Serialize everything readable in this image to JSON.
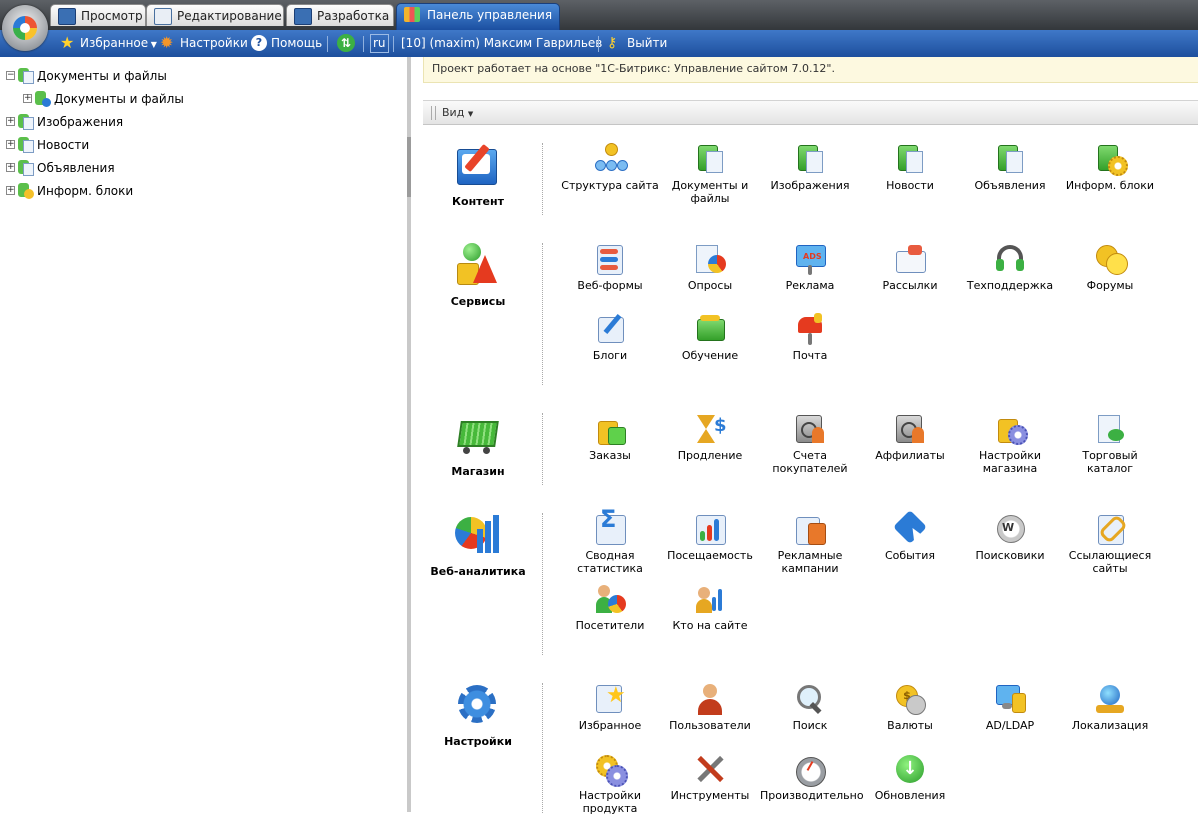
{
  "tabs": [
    {
      "label": "Просмотр",
      "color": "#3a6fb3"
    },
    {
      "label": "Редактирование",
      "color": "#3a6fb3"
    },
    {
      "label": "Разработка",
      "color": "#3a6fb3"
    },
    {
      "label": "Панель управления",
      "color": "#f2b32c",
      "active": true
    }
  ],
  "toolbar": {
    "favorites": "Избранное",
    "settings": "Настройки",
    "help": "Помощь",
    "lang": "ru",
    "user": "[10] (maxim) Максим Гаврильев",
    "logout": "Выйти"
  },
  "tree": [
    {
      "label": "Документы и файлы",
      "expander": "−",
      "level": 0
    },
    {
      "label": "Документы и файлы",
      "expander": "+",
      "level": 1
    },
    {
      "label": "Изображения",
      "expander": "+",
      "level": 0
    },
    {
      "label": "Новости",
      "expander": "+",
      "level": 0
    },
    {
      "label": "Объявления",
      "expander": "+",
      "level": 0
    },
    {
      "label": "Информ. блоки",
      "expander": "+",
      "level": 0
    }
  ],
  "notice": "Проект работает на основе \"1С-Битрикс: Управление сайтом 7.0.12\".",
  "view_menu": "Вид",
  "sections": [
    {
      "title": "Контент",
      "icon": "content-icon",
      "items": [
        {
          "label": "Структура сайта",
          "icon": "site-structure-icon"
        },
        {
          "label": "Документы и файлы",
          "icon": "documents-icon"
        },
        {
          "label": "Изображения",
          "icon": "images-icon"
        },
        {
          "label": "Новости",
          "icon": "news-icon"
        },
        {
          "label": "Объявления",
          "icon": "ads-list-icon"
        },
        {
          "label": "Информ. блоки",
          "icon": "iblocks-icon"
        }
      ]
    },
    {
      "title": "Сервисы",
      "icon": "services-icon",
      "items": [
        {
          "label": "Веб-формы",
          "icon": "webforms-icon"
        },
        {
          "label": "Опросы",
          "icon": "polls-icon"
        },
        {
          "label": "Реклама",
          "icon": "advertising-icon"
        },
        {
          "label": "Рассылки",
          "icon": "mailing-icon"
        },
        {
          "label": "Техподдержка",
          "icon": "support-icon"
        },
        {
          "label": "Форумы",
          "icon": "forums-icon"
        },
        {
          "label": "Блоги",
          "icon": "blogs-icon"
        },
        {
          "label": "Обучение",
          "icon": "learning-icon"
        },
        {
          "label": "Почта",
          "icon": "mail-icon"
        }
      ]
    },
    {
      "title": "Магазин",
      "icon": "shop-cart-icon",
      "items": [
        {
          "label": "Заказы",
          "icon": "orders-icon"
        },
        {
          "label": "Продление",
          "icon": "renewal-icon"
        },
        {
          "label": "Счета покупателей",
          "icon": "customer-accounts-icon"
        },
        {
          "label": "Аффилиаты",
          "icon": "affiliates-icon"
        },
        {
          "label": "Настройки магазина",
          "icon": "shop-settings-icon"
        },
        {
          "label": "Торговый каталог",
          "icon": "catalog-icon"
        }
      ]
    },
    {
      "title": "Веб-аналитика",
      "icon": "analytics-icon",
      "items": [
        {
          "label": "Сводная статистика",
          "icon": "summary-stats-icon"
        },
        {
          "label": "Посещаемость",
          "icon": "traffic-icon"
        },
        {
          "label": "Рекламные кампании",
          "icon": "campaigns-icon"
        },
        {
          "label": "События",
          "icon": "events-icon"
        },
        {
          "label": "Поисковики",
          "icon": "search-engines-icon"
        },
        {
          "label": "Ссылающиеся сайты",
          "icon": "referrers-icon"
        },
        {
          "label": "Посетители",
          "icon": "visitors-icon"
        },
        {
          "label": "Кто на сайте",
          "icon": "who-online-icon"
        }
      ]
    },
    {
      "title": "Настройки",
      "icon": "settings-gear-icon",
      "items": [
        {
          "label": "Избранное",
          "icon": "favorites-icon"
        },
        {
          "label": "Пользователи",
          "icon": "users-icon"
        },
        {
          "label": "Поиск",
          "icon": "search-icon"
        },
        {
          "label": "Валюты",
          "icon": "currencies-icon"
        },
        {
          "label": "AD/LDAP",
          "icon": "ldap-icon"
        },
        {
          "label": "Локализация",
          "icon": "localization-icon"
        },
        {
          "label": "Настройки продукта",
          "icon": "product-settings-icon"
        },
        {
          "label": "Инструменты",
          "icon": "tools-icon"
        },
        {
          "label": "Производительно",
          "icon": "performance-icon"
        },
        {
          "label": "Обновления",
          "icon": "updates-icon"
        }
      ]
    }
  ]
}
